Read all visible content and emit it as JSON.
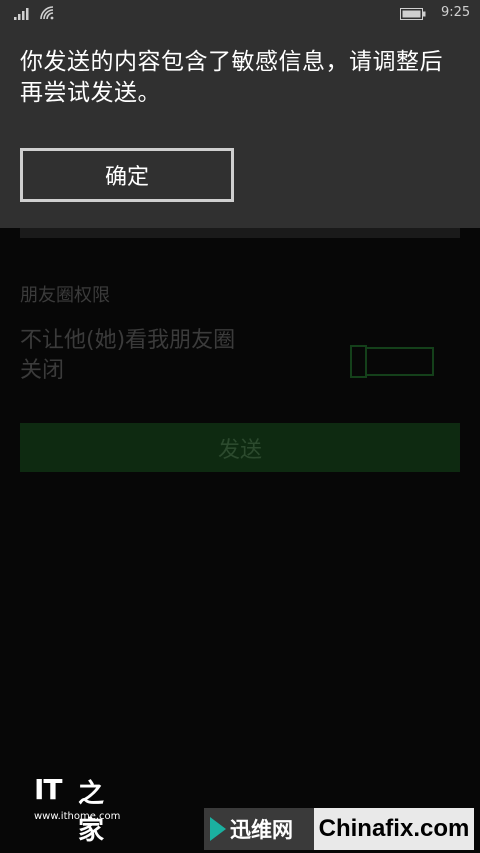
{
  "status_bar": {
    "time": "9:25",
    "icons": [
      "signal-icon",
      "wifi-icon",
      "battery-icon"
    ]
  },
  "dialog": {
    "message": "你发送的内容包含了敏感信息，请调整后再尝试发送。",
    "confirm_label": "确定"
  },
  "form": {
    "section_header": "朋友圈权限",
    "toggle_label": "不让他(她)看我朋友圈",
    "toggle_state": "关闭",
    "toggle_on": false,
    "send_label": "发送"
  },
  "watermarks": {
    "ithome_logo": "IT之家",
    "ithome_url": "www.ithome.com",
    "xunwei": "迅维网",
    "chinafix": "Chinafix.com"
  },
  "colors": {
    "background": "#070707",
    "dialog": "#303030",
    "send_button": "#0e2a11",
    "toggle_border": "#14401a"
  }
}
